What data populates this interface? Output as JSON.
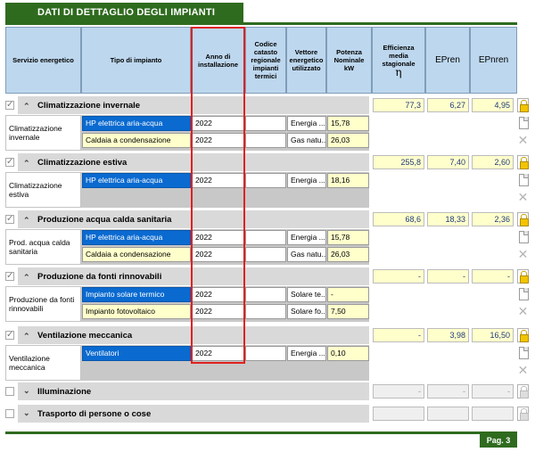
{
  "header": {
    "title": "DATI DI DETTAGLIO DEGLI IMPIANTI"
  },
  "columns": {
    "servizio": "Servizio energetico",
    "tipo": "Tipo di impianto",
    "anno": "Anno di installazione",
    "codice": "Codice catasto regionale impianti termici",
    "vettore": "Vettore energetico utilizzato",
    "potenza": "Potenza Nominale kW",
    "efficienza": "Efficienza media stagionale",
    "efficienza_symbol": "η",
    "epren": "EPren",
    "epnren": "EPnren"
  },
  "sections": [
    {
      "label": "Climatizzazione invernale",
      "checked": true,
      "expanded": true,
      "efficienza": "77,3",
      "epren": "6,27",
      "epnren": "4,95",
      "detail_label": "Climatizzazione invernale",
      "rows": [
        {
          "tipo": "HP elettrica aria-acqua",
          "tipo_style": "blue",
          "anno": "2022",
          "codice": "",
          "vettore": "Energia ...",
          "potenza": "15,78"
        },
        {
          "tipo": "Caldaia a condensazione",
          "tipo_style": "yellow",
          "anno": "2022",
          "codice": "",
          "vettore": "Gas natu...",
          "potenza": "26,03"
        }
      ]
    },
    {
      "label": "Climatizzazione estiva",
      "checked": true,
      "expanded": true,
      "efficienza": "255,8",
      "epren": "7,40",
      "epnren": "2,60",
      "detail_label": "Climatizzazione estiva",
      "rows": [
        {
          "tipo": "HP elettrica aria-acqua",
          "tipo_style": "blue",
          "anno": "2022",
          "codice": "",
          "vettore": "Energia ...",
          "potenza": "18,16"
        }
      ]
    },
    {
      "label": "Produzione acqua calda sanitaria",
      "checked": true,
      "expanded": true,
      "efficienza": "68,6",
      "epren": "18,33",
      "epnren": "2,36",
      "detail_label": "Prod. acqua calda sanitaria",
      "rows": [
        {
          "tipo": "HP elettrica aria-acqua",
          "tipo_style": "blue",
          "anno": "2022",
          "codice": "",
          "vettore": "Energia ...",
          "potenza": "15,78"
        },
        {
          "tipo": "Caldaia a condensazione",
          "tipo_style": "yellow",
          "anno": "2022",
          "codice": "",
          "vettore": "Gas natu...",
          "potenza": "26,03"
        }
      ]
    },
    {
      "label": "Produzione da fonti rinnovabili",
      "checked": true,
      "expanded": true,
      "efficienza": "-",
      "epren": "-",
      "epnren": "-",
      "detail_label": "Produzione da fonti rinnovabili",
      "rows": [
        {
          "tipo": "Impianto solare termico",
          "tipo_style": "blue",
          "anno": "2022",
          "codice": "",
          "vettore": "Solare te...",
          "potenza": "-"
        },
        {
          "tipo": "Impianto fotovoltaico",
          "tipo_style": "yellow",
          "anno": "2022",
          "codice": "",
          "vettore": "Solare fo...",
          "potenza": "7,50"
        }
      ]
    },
    {
      "label": "Ventilazione meccanica",
      "checked": true,
      "expanded": true,
      "efficienza": "-",
      "epren": "3,98",
      "epnren": "16,50",
      "detail_label": "Ventilazione meccanica",
      "rows": [
        {
          "tipo": "Ventilatori",
          "tipo_style": "blue",
          "anno": "2022",
          "codice": "",
          "vettore": "Energia ...",
          "potenza": "0,10"
        }
      ]
    },
    {
      "label": "Illuminazione",
      "checked": false,
      "expanded": false,
      "efficienza": "-",
      "epren": "-",
      "epnren": "-",
      "rows": []
    },
    {
      "label": "Trasporto di persone o cose",
      "checked": false,
      "expanded": false,
      "efficienza": "",
      "epren": "",
      "epnren": "",
      "rows": []
    }
  ],
  "footer": {
    "page": "Pag. 3"
  },
  "colors": {
    "brand_green": "#2f6b1f",
    "header_blue": "#bdd7ee",
    "selected_blue": "#0a6ad0",
    "field_yellow": "#ffffcc",
    "highlight_red": "#e02020"
  }
}
